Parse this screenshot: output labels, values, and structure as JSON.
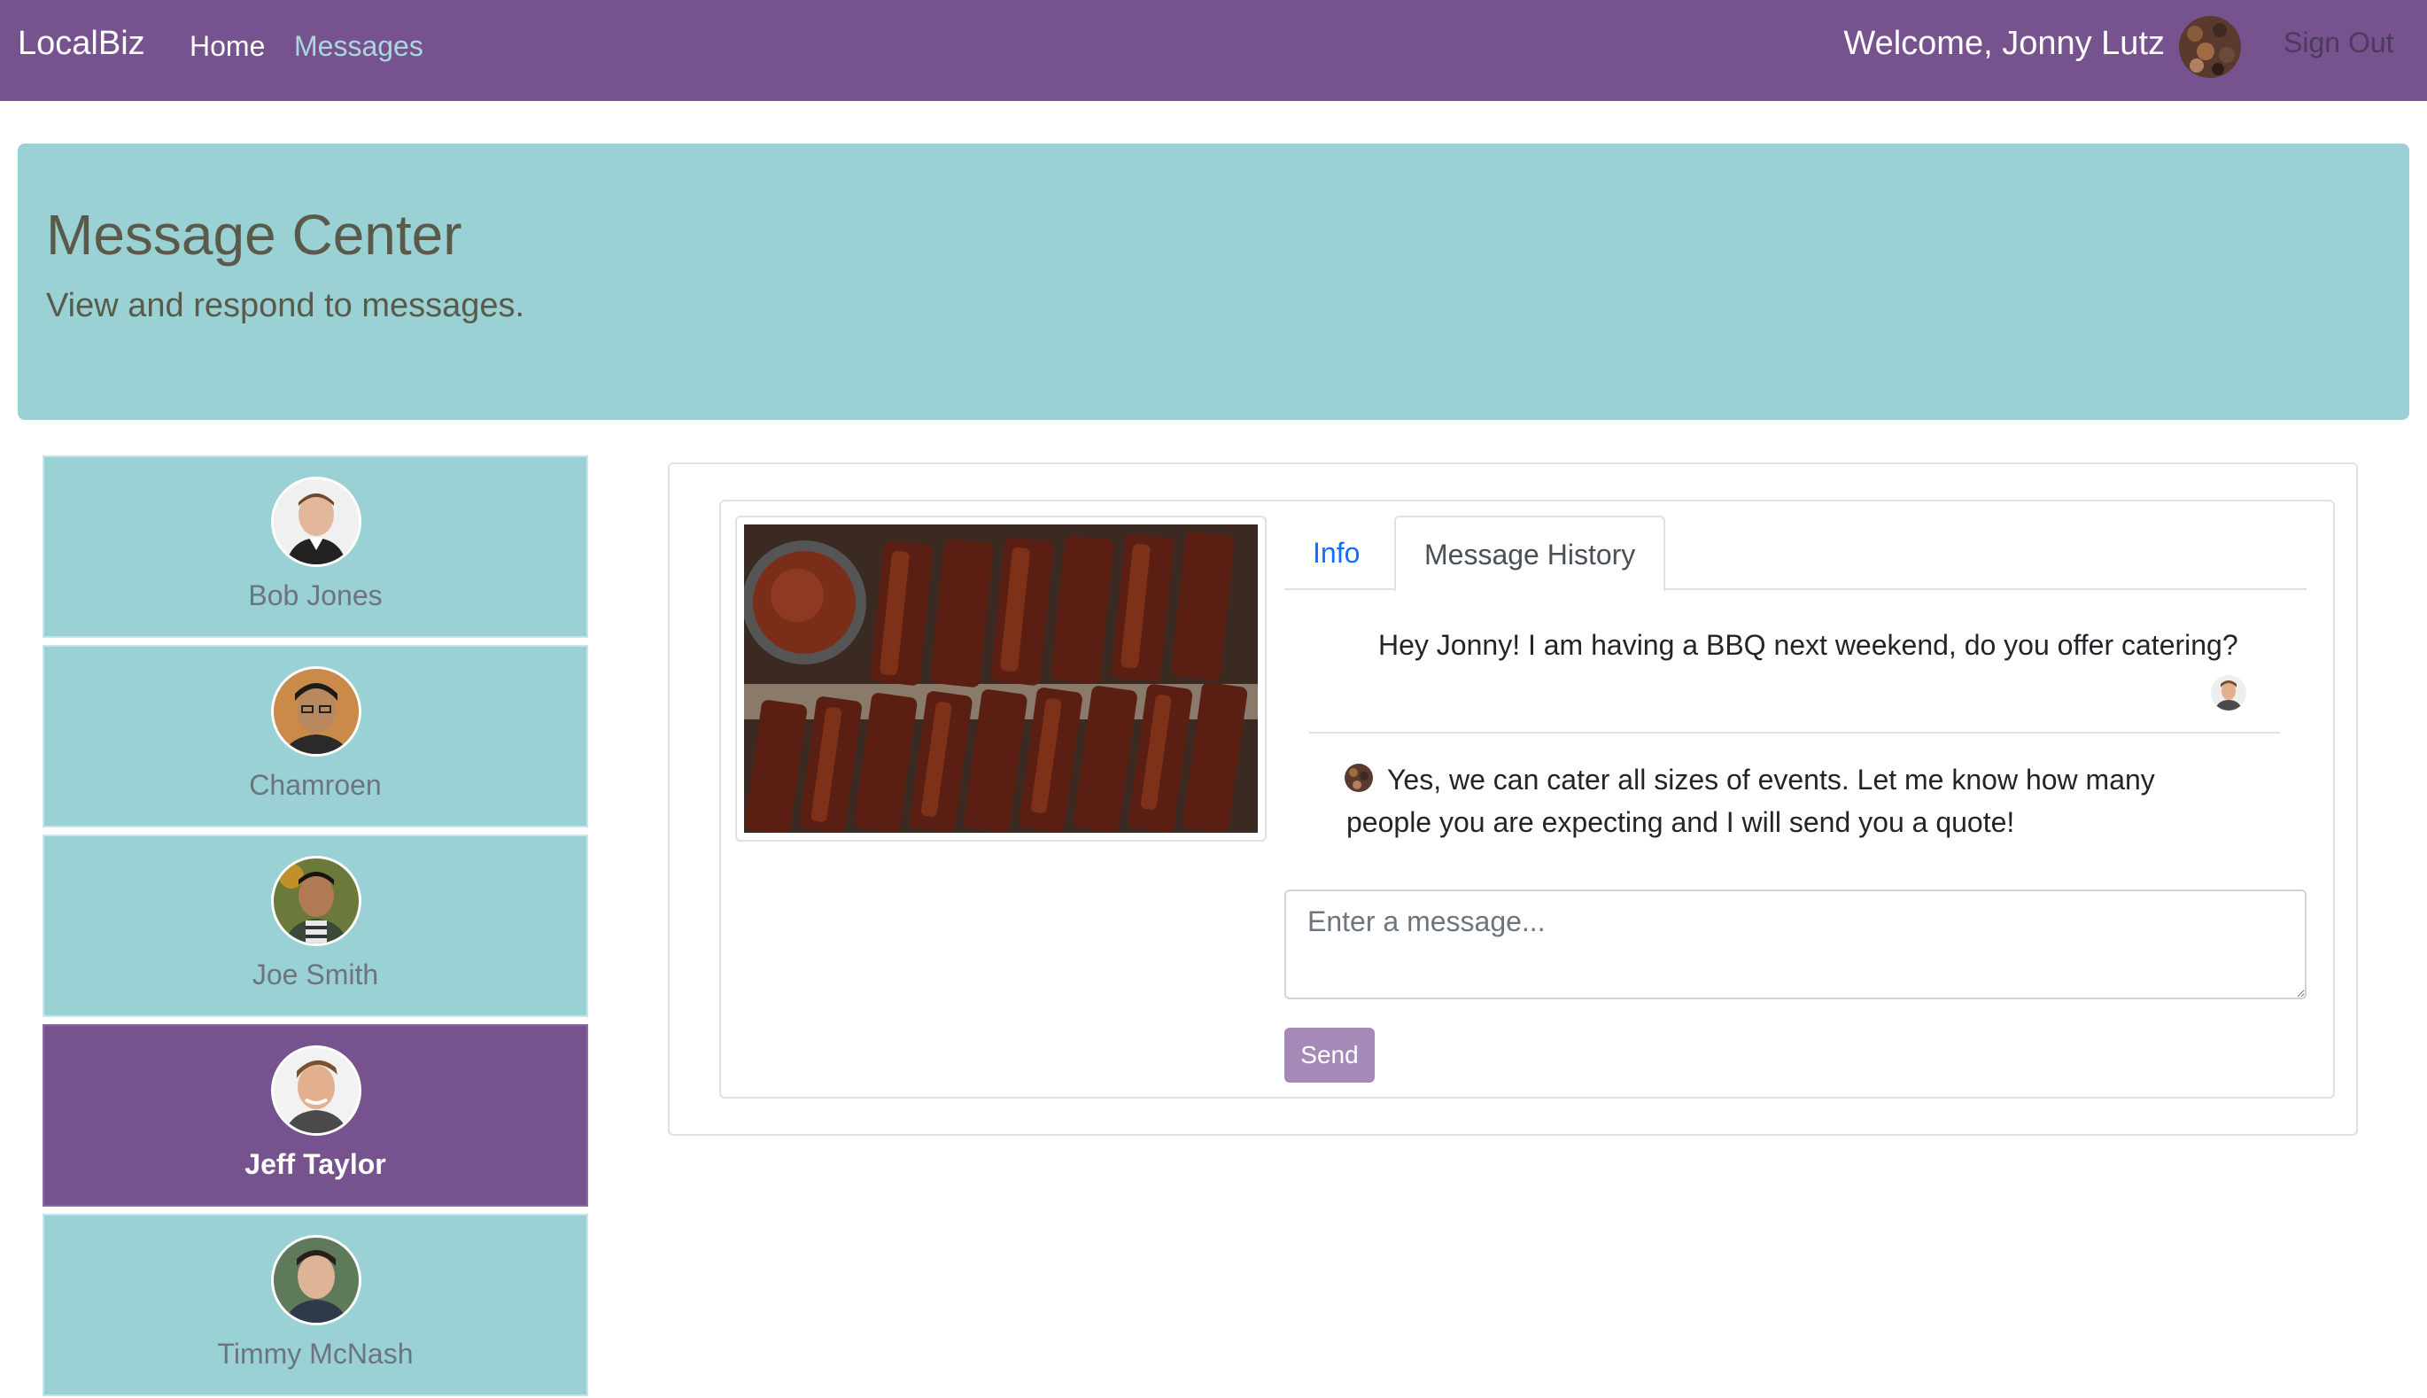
{
  "navbar": {
    "brand": "LocalBiz",
    "links": [
      "Home",
      "Messages"
    ],
    "welcome": "Welcome, Jonny Lutz",
    "sign_out": "Sign Out"
  },
  "jumbotron": {
    "title": "Message Center",
    "subtitle": "View and respond to messages."
  },
  "contacts": [
    {
      "name": "Bob Jones",
      "active": false
    },
    {
      "name": "Chamroen",
      "active": false
    },
    {
      "name": "Joe Smith",
      "active": false
    },
    {
      "name": "Jeff Taylor",
      "active": true
    },
    {
      "name": "Timmy McNash",
      "active": false
    }
  ],
  "tabs": {
    "info": "Info",
    "history": "Message History",
    "active": "history"
  },
  "messages": [
    {
      "from": "customer",
      "text": "Hey Jonny! I am having a BBQ next weekend, do you offer catering?"
    },
    {
      "from": "me",
      "text": "Yes, we can cater all sizes of events. Let me know how many people you are expecting and I will send you a quote!"
    }
  ],
  "composer": {
    "placeholder": "Enter a message...",
    "send_label": "Send"
  },
  "colors": {
    "navbar": "#76528f",
    "teal": "#9ad1d4",
    "active_contact": "#76528f",
    "link_blue": "#0d6efd",
    "send_button": "#a58ab8"
  }
}
